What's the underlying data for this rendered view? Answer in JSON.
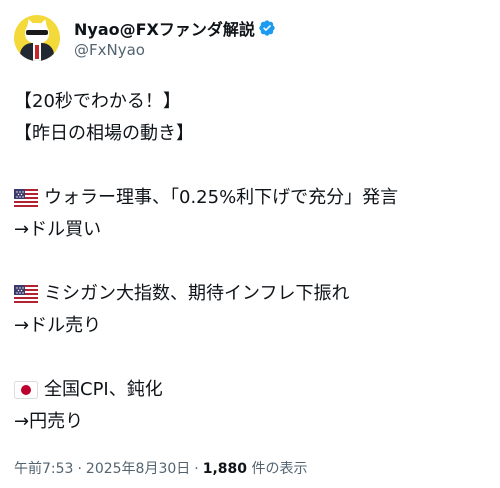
{
  "author": {
    "display_name": "Nyao@FXファンダ解説",
    "handle": "@FxNyao",
    "verified_icon": "verified-badge-icon",
    "accent_color": "#1d9bf0"
  },
  "tweet": {
    "lines": [
      {
        "text": "【20秒でわかる！】"
      },
      {
        "text": "【昨日の相場の動き】"
      },
      {
        "text": "ウォラー理事、「0.25%利下げで充分」発言",
        "flag": "us-flag-icon"
      },
      {
        "text": "→ドル買い"
      },
      {
        "text": "ミシガン大指数、期待インフレ下振れ",
        "flag": "us-flag-icon"
      },
      {
        "text": "→ドル売り"
      },
      {
        "text": "全国CPI、鈍化",
        "flag": "japan-flag-icon"
      },
      {
        "text": "→円売り"
      }
    ]
  },
  "meta": {
    "time": "午前7:53",
    "date": "2025年8月30日",
    "views_count": "1,880",
    "views_label": "件の表示",
    "separator": "·"
  }
}
